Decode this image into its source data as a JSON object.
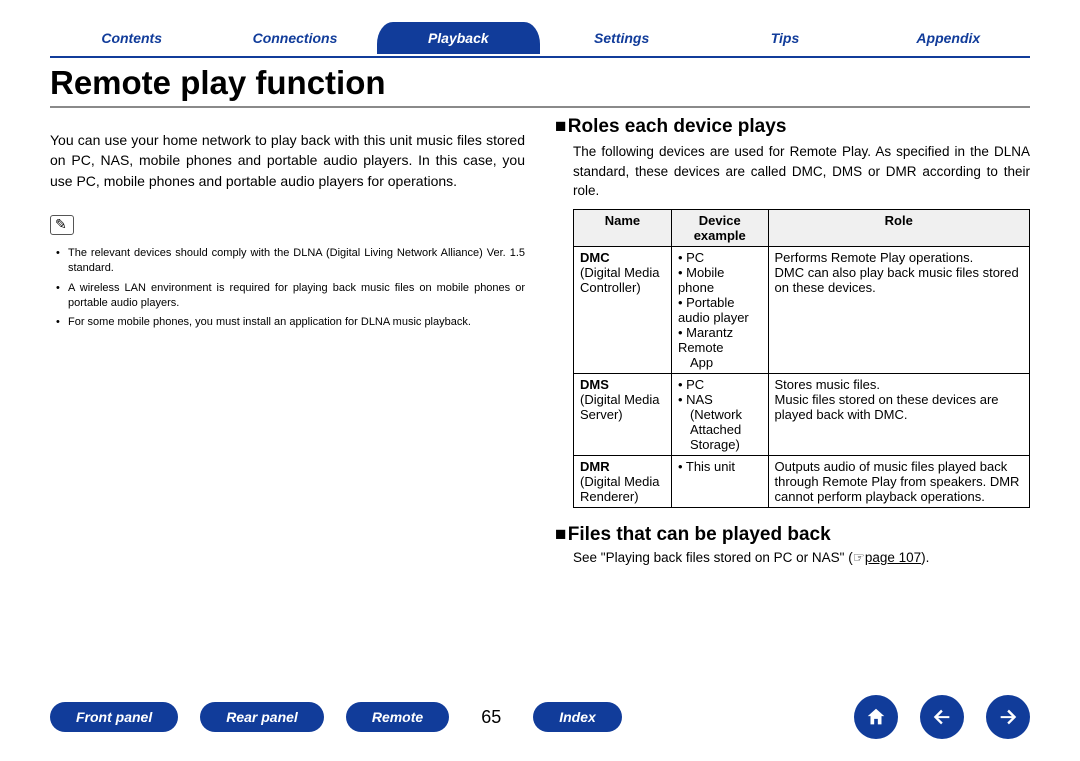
{
  "nav": {
    "contents": "Contents",
    "connections": "Connections",
    "playback": "Playback",
    "settings": "Settings",
    "tips": "Tips",
    "appendix": "Appendix"
  },
  "title": "Remote play function",
  "intro": "You can use your home network to play back with this unit music files stored on PC, NAS, mobile phones and portable audio players. In this case, you use PC, mobile phones and portable audio players for operations.",
  "notes": [
    "The relevant devices should comply with the DLNA (Digital Living Network Alliance) Ver. 1.5 standard.",
    "A wireless LAN environment is required for playing back music files on mobile phones or portable audio players.",
    "For some mobile phones, you must install an application for DLNA music playback."
  ],
  "roles_heading": "Roles each device plays",
  "roles_sub": "The following devices are used for Remote Play. As specified in the DLNA standard, these devices are called DMC, DMS or DMR according to their role.",
  "table": {
    "headers": {
      "name": "Name",
      "device": "Device example",
      "role": "Role"
    },
    "rows": [
      {
        "name_abbr": "DMC",
        "name_full": "(Digital Media Controller)",
        "devices": [
          "PC",
          "Mobile phone",
          "Portable audio player",
          "Marantz Remote",
          "  App"
        ],
        "device_sub_lines": [
          false,
          false,
          false,
          false,
          true
        ],
        "role": "Performs Remote Play operations.\nDMC can also play back music files stored on these devices."
      },
      {
        "name_abbr": "DMS",
        "name_full": "(Digital Media Server)",
        "devices": [
          "PC",
          "NAS",
          "  (Network Attached",
          "  Storage)"
        ],
        "device_sub_lines": [
          false,
          false,
          true,
          true
        ],
        "role": "Stores music files.\nMusic files stored on these devices are played back with DMC."
      },
      {
        "name_abbr": "DMR",
        "name_full": "(Digital Media Renderer)",
        "devices": [
          "This unit"
        ],
        "device_sub_lines": [
          false
        ],
        "role": "Outputs audio of music files played back through Remote Play from speakers. DMR cannot perform playback operations."
      }
    ]
  },
  "files_heading": "Files that can be played back",
  "files_text_a": "See \"Playing back files stored on PC or NAS\" (☞",
  "files_link": "page 107",
  "files_text_b": ").",
  "bottom": {
    "front": "Front panel",
    "rear": "Rear panel",
    "remote": "Remote",
    "index": "Index",
    "page": "65"
  },
  "chart_data": {
    "type": "table",
    "title": "Roles each device plays",
    "columns": [
      "Name",
      "Device example",
      "Role"
    ],
    "rows": [
      [
        "DMC (Digital Media Controller)",
        "PC; Mobile phone; Portable audio player; Marantz Remote App",
        "Performs Remote Play operations. DMC can also play back music files stored on these devices."
      ],
      [
        "DMS (Digital Media Server)",
        "PC; NAS (Network Attached Storage)",
        "Stores music files. Music files stored on these devices are played back with DMC."
      ],
      [
        "DMR (Digital Media Renderer)",
        "This unit",
        "Outputs audio of music files played back through Remote Play from speakers. DMR cannot perform playback operations."
      ]
    ]
  }
}
